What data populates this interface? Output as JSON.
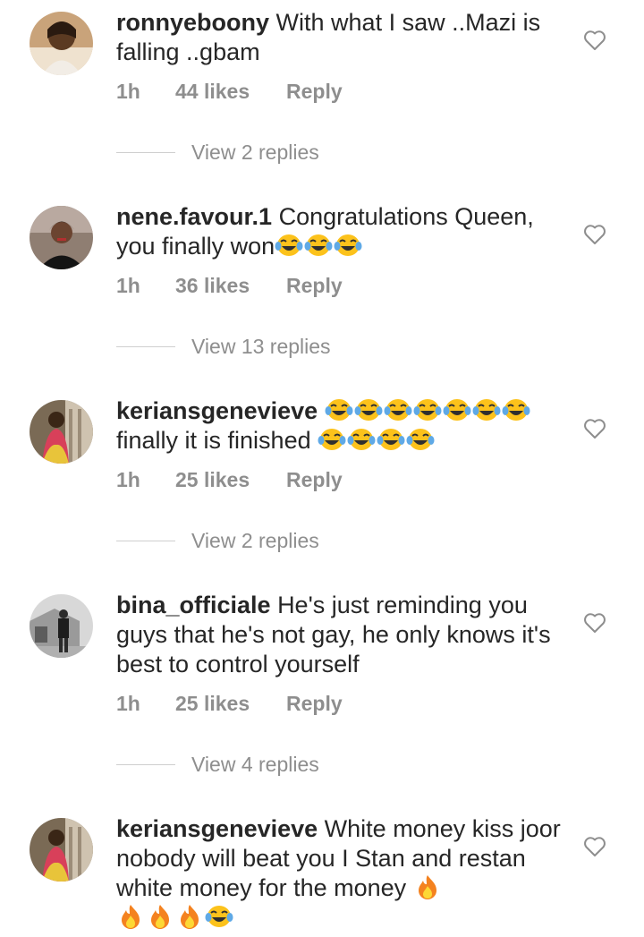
{
  "comments": [
    {
      "username": "ronnyeboony",
      "text": "With what I saw ..Mazi is falling ..gbam",
      "emoji_suffix": [],
      "emoji_suffix_2": [],
      "time": "1h",
      "likes": "44 likes",
      "reply": "Reply",
      "view_replies": "View 2 replies"
    },
    {
      "username": "nene.favour.1",
      "text": "Congratulations Queen, you finally won",
      "emoji_suffix": [
        "tears-of-joy-emoji",
        "tears-of-joy-emoji",
        "tears-of-joy-emoji"
      ],
      "time": "1h",
      "likes": "36 likes",
      "reply": "Reply",
      "view_replies": "View 13 replies"
    },
    {
      "username": "keriansgenevieve",
      "text": "finally it is finished",
      "emoji_prefix": [
        "tears-of-joy-emoji",
        "tears-of-joy-emoji",
        "tears-of-joy-emoji",
        "tears-of-joy-emoji",
        "tears-of-joy-emoji",
        "tears-of-joy-emoji",
        "tears-of-joy-emoji"
      ],
      "emoji_suffix": [
        "tears-of-joy-emoji",
        "tears-of-joy-emoji",
        "tears-of-joy-emoji",
        "tears-of-joy-emoji"
      ],
      "time": "1h",
      "likes": "25 likes",
      "reply": "Reply",
      "view_replies": "View 2 replies"
    },
    {
      "username": "bina_officiale",
      "text": "He's just reminding you guys that he's not gay, he only knows it's best to control yourself",
      "time": "1h",
      "likes": "25 likes",
      "reply": "Reply",
      "view_replies": "View 4 replies"
    },
    {
      "username": "keriansgenevieve",
      "text": "White money kiss joor nobody will beat you I Stan and restan white money for the money",
      "emoji_suffix": [
        "fire-emoji",
        "fire-emoji",
        "fire-emoji",
        "fire-emoji",
        "tears-of-joy-emoji"
      ]
    }
  ],
  "colors": {
    "text": "#262626",
    "muted": "#8e8e8e",
    "divider": "#cfcfcf"
  }
}
